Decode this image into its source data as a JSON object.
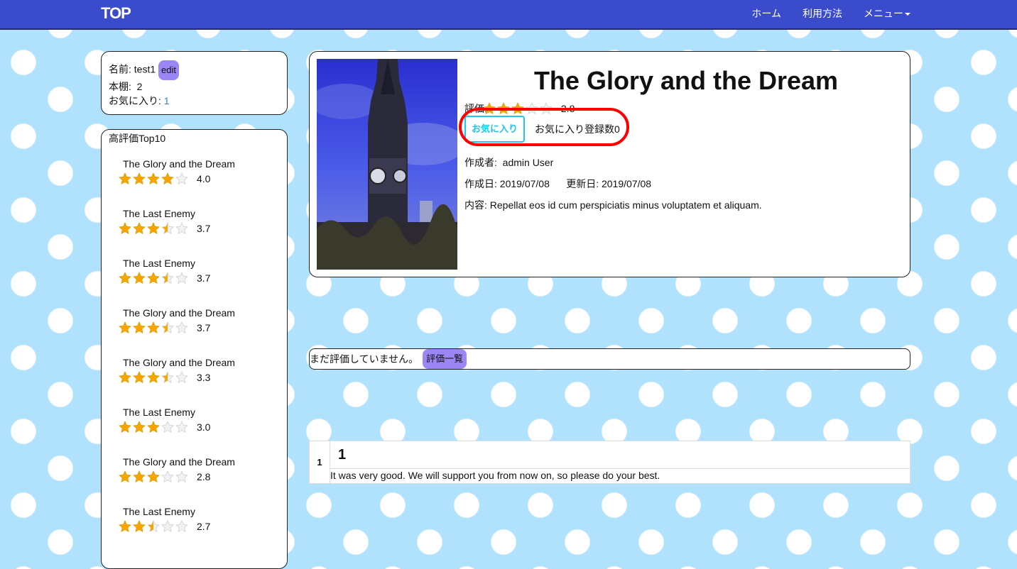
{
  "nav": {
    "brand": "TOP",
    "links": [
      "ホーム",
      "利用方法",
      "メニュー"
    ],
    "color": "#3a4ccb"
  },
  "profile": {
    "name_label": "名前:",
    "name": "test1",
    "edit": "edit",
    "shelf_label": "本棚:",
    "shelf": "2",
    "fav_label": "お気に入り:",
    "fav": "1"
  },
  "ranking": {
    "title": "高評価Top10",
    "items": [
      {
        "title": "The Glory and the Dream",
        "stars": [
          1,
          1,
          1,
          1,
          0
        ],
        "value": "4.0"
      },
      {
        "title": "The Last Enemy",
        "stars": [
          1,
          1,
          1,
          0.5,
          0
        ],
        "value": "3.7"
      },
      {
        "title": "The Last Enemy",
        "stars": [
          1,
          1,
          1,
          0.5,
          0
        ],
        "value": "3.7"
      },
      {
        "title": "The Glory and the Dream",
        "stars": [
          1,
          1,
          1,
          0.5,
          0
        ],
        "value": "3.7"
      },
      {
        "title": "The Glory and the Dream",
        "stars": [
          1,
          1,
          1,
          0.5,
          0
        ],
        "value": "3.3"
      },
      {
        "title": "The Last Enemy",
        "stars": [
          1,
          1,
          1,
          0,
          0
        ],
        "value": "3.0"
      },
      {
        "title": "The Glory and the Dream",
        "stars": [
          1,
          1,
          1,
          0,
          0
        ],
        "value": "2.8"
      },
      {
        "title": "The Last Enemy",
        "stars": [
          1,
          1,
          0.5,
          0,
          0
        ],
        "value": "2.7"
      }
    ]
  },
  "book": {
    "title": "The Glory and the Dream",
    "rating_label": "評価:",
    "stars": [
      1,
      1,
      1,
      0,
      0
    ],
    "rating": "2.8",
    "fav_button": "お気に入り",
    "fav_count": "お気に入り登録数0",
    "author_label": "作成者:",
    "author": "admin User",
    "created_label": "作成日:",
    "created": "2019/07/08",
    "updated_label": "更新日:",
    "updated": "2019/07/08",
    "content_label": "内容:",
    "content": "Repellat eos id cum perspiciatis minus voluptatem et aliquam."
  },
  "review_bar": {
    "text": "まだ評価していません。",
    "list_button": "評価一覧"
  },
  "reviews": [
    {
      "rating": "1",
      "title": "1",
      "body": "It was very good. We will support you from now on, so please do your best."
    }
  ],
  "colors": {
    "star": "#f7a600",
    "star_empty": "#dddddd",
    "accent": "#9b86f5",
    "fav": "#1ec5f0",
    "highlight": "#ff0000"
  }
}
